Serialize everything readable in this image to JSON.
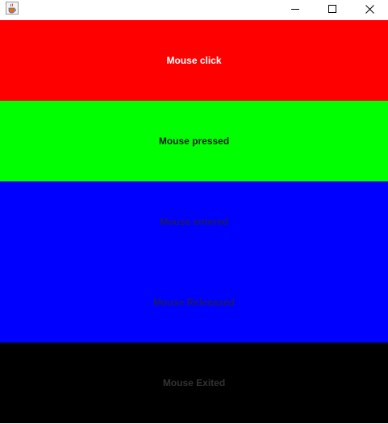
{
  "window": {
    "controls": {
      "minimize_icon": "minimize-icon",
      "maximize_icon": "maximize-icon",
      "close_icon": "close-icon"
    },
    "app_icon": "java-cup-icon"
  },
  "panels": [
    {
      "label": "Mouse click",
      "background": "#ff0000",
      "text_color": "#ffffff"
    },
    {
      "label": "Mouse pressed",
      "background": "#00ff00",
      "text_color": "#1a1a1a"
    },
    {
      "label": "Mouse entered",
      "background": "#0000ff",
      "text_color": "#1a1a66"
    },
    {
      "label": "Mouse Releeased",
      "background": "#0000ff",
      "text_color": "#1a1a66"
    },
    {
      "label": "Mouse Exited",
      "background": "#000000",
      "text_color": "#333333"
    }
  ]
}
